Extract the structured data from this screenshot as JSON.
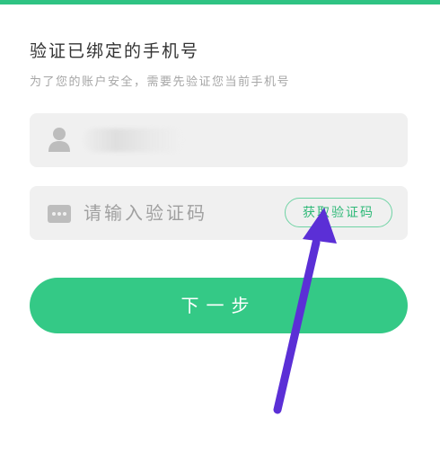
{
  "header": {
    "title": "验证已绑定的手机号",
    "subtitle": "为了您的账户安全，需要先验证您当前手机号"
  },
  "phone_field": {
    "icon": "user-icon",
    "value": ""
  },
  "code_field": {
    "icon": "message-icon",
    "placeholder": "请输入验证码",
    "value": ""
  },
  "buttons": {
    "get_code_label": "获取验证码",
    "next_label": "下一步"
  },
  "colors": {
    "accent": "#2fc383",
    "button_bg": "#34c986",
    "annotation_arrow": "#5b2fd6"
  }
}
